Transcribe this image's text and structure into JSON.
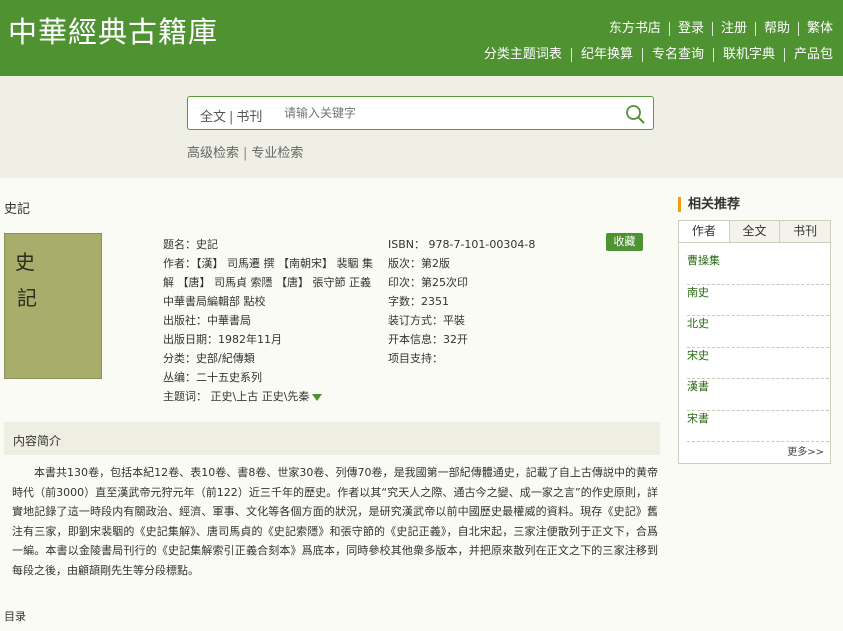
{
  "header": {
    "logo": "中華經典古籍庫",
    "top_links": [
      "东方书店",
      "登录",
      "注册",
      "帮助",
      "繁体"
    ],
    "nav_links": [
      "分类主题词表",
      "纪年换算",
      "专名查询",
      "联机字典",
      "产品包"
    ]
  },
  "search": {
    "scope_fulltext": "全文",
    "scope_sep": "|",
    "scope_journal": "书刊",
    "placeholder": "请输入关键字",
    "advanced": "高级检索",
    "adv_sep": "|",
    "professional": "专业检索"
  },
  "book": {
    "heading": "史記",
    "cover_chars": [
      "史",
      "記"
    ],
    "collect_label": "收藏",
    "meta_left": [
      "题名：史記",
      "作者：【漢】 司馬遷 撰 【南朝宋】 裴駰 集解 【唐】 司馬貞 索隱 【唐】 張守節 正義 中華書局編輯部 點校",
      "出版社：中華書局",
      "出版日期：1982年11月",
      "分类：史部/紀傳類",
      "丛编：二十五史系列",
      "主题词： 正史\\上古 正史\\先秦"
    ],
    "meta_right": [
      "ISBN： 978-7-101-00304-8",
      "版次：第2版",
      "印次：第25次印",
      "字数：2351",
      "装订方式：平裝",
      "开本信息：32开",
      "项目支持："
    ]
  },
  "intro": {
    "title": "内容简介",
    "text": "本書共130卷，包括本紀12卷、表10卷、書8卷、世家30卷、列傳70卷，是我國第一部紀傳體通史，記載了自上古傳説中的黄帝時代（前3000）直至漢武帝元狩元年（前122）近三千年的歷史。作者以其“究天人之際、通古今之變、成一家之言”的作史原則，詳實地記錄了這一時段内有關政治、經濟、軍事、文化等各個方面的狀況，是研究漢武帝以前中國歷史最權威的資料。現存《史記》舊注有三家，即劉宋裴駰的《史記集解》、唐司馬貞的《史記索隱》和張守節的《史記正義》，自北宋起，三家注便散列于正文下，合爲一編。本書以金陵書局刊行的《史記集解索引正義合刻本》爲底本，同時參校其他衆多版本，并把原來散列在正文之下的三家注移到每段之後，由顧頡剛先生等分段標點。"
  },
  "toc": {
    "label": "目录"
  },
  "sidebar": {
    "title": "相关推荐",
    "tabs": [
      "作者",
      "全文",
      "书刊"
    ],
    "items": [
      "曹操集",
      "南史",
      "北史",
      "宋史",
      "漢書",
      "宋書"
    ],
    "more": "更多>>"
  },
  "colors": {
    "brand_green": "#4f9232",
    "accent_orange": "#f39c12"
  },
  "icons": {
    "search": "search-icon",
    "expand": "triangle-down-icon"
  }
}
